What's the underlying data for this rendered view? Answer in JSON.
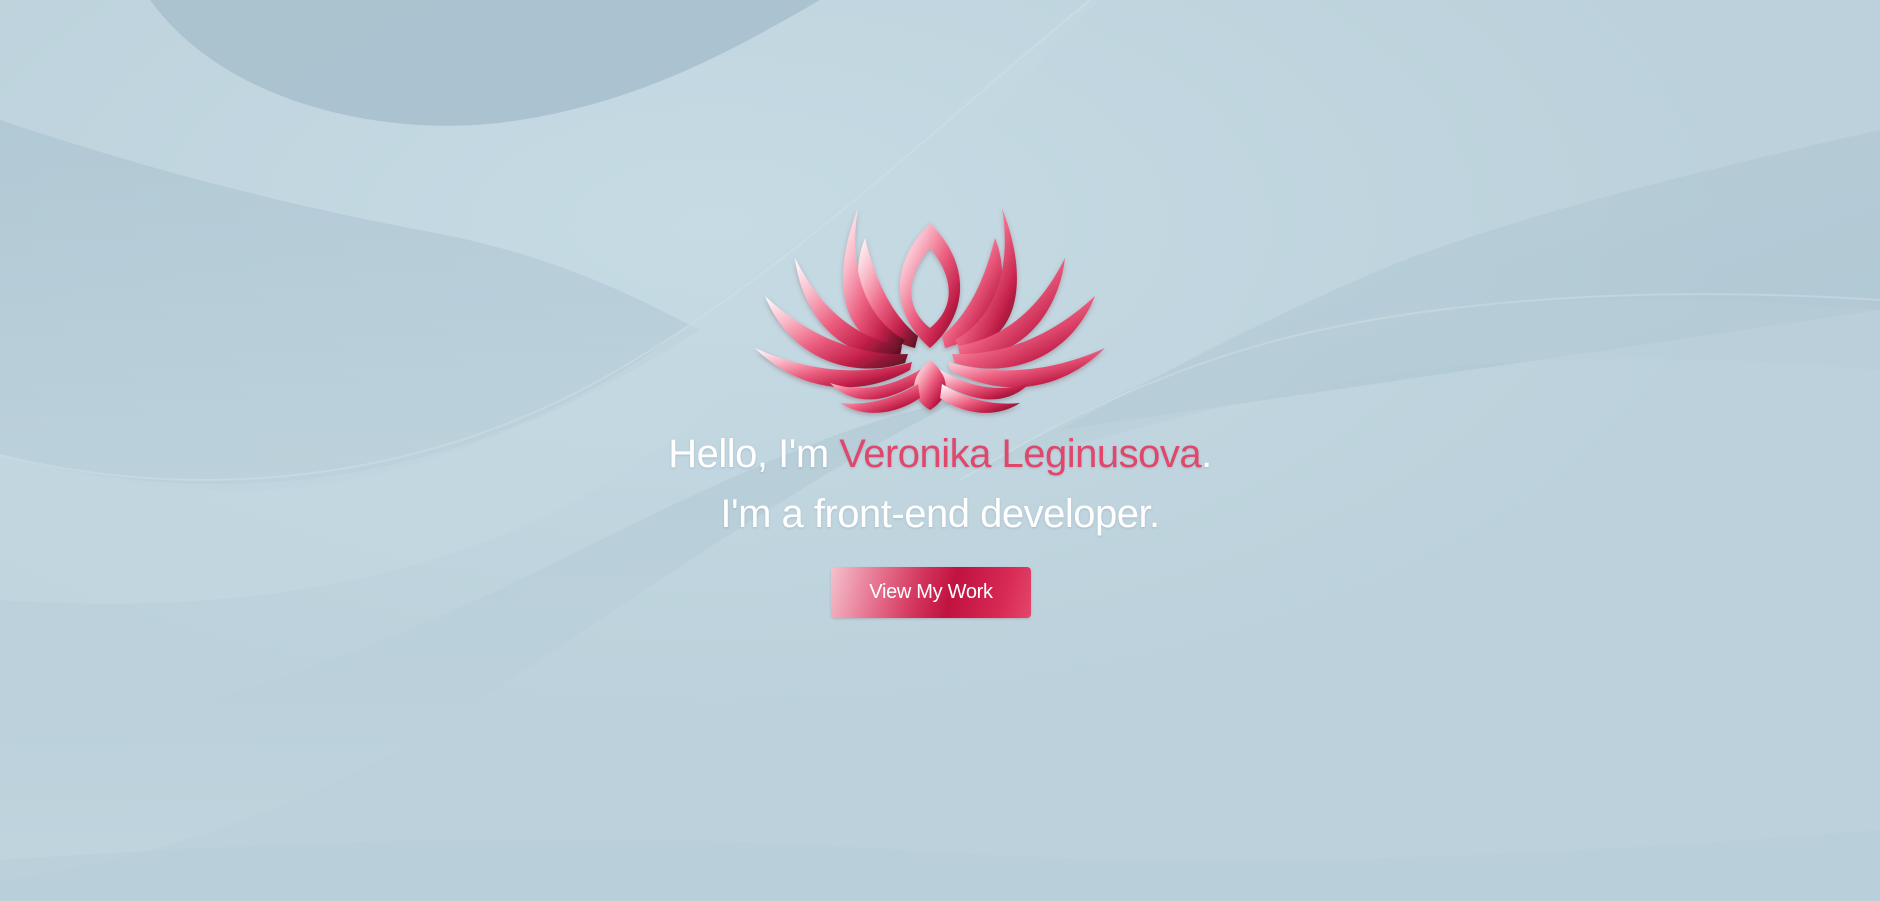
{
  "hero": {
    "greeting_prefix": "Hello, I'm ",
    "name": "Veronika Leginusova",
    "greeting_suffix": ".",
    "tagline": "I'm a front-end developer.",
    "cta_label": "View My Work",
    "logo_icon": "lotus-icon"
  },
  "colors": {
    "background": "#bfd4de",
    "accent": "#e0476b",
    "button": "#c11240",
    "text": "#ffffff"
  }
}
